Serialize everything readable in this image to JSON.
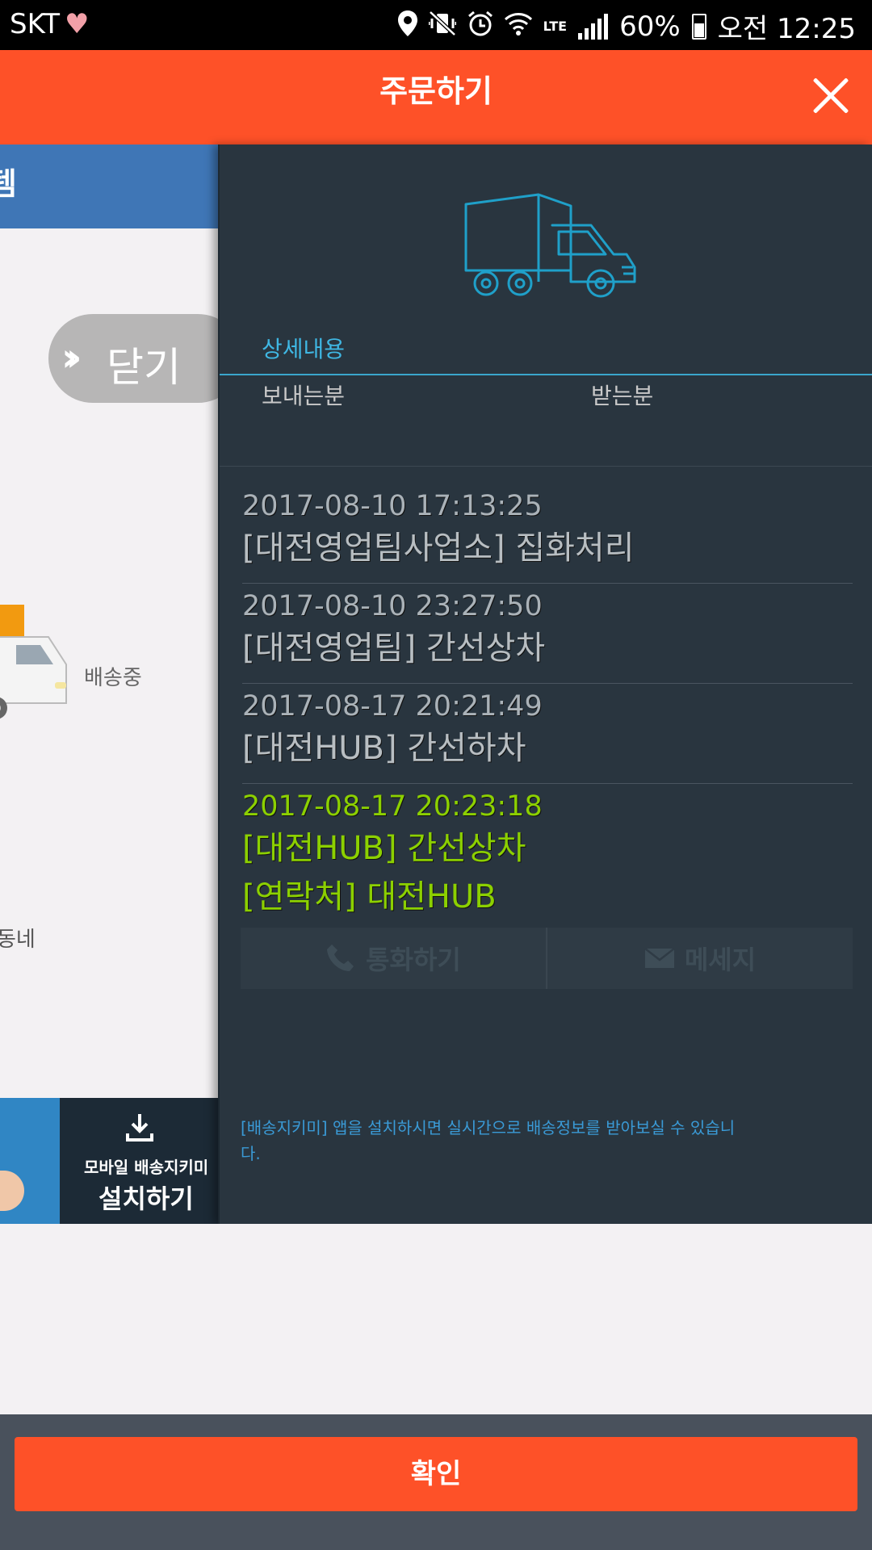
{
  "status_bar": {
    "carrier": "SKT",
    "battery": "60%",
    "clock": "오전 12:25",
    "network": "LTE",
    "icons": [
      "heart-icon",
      "location-icon",
      "vibrate-icon",
      "alarm-icon",
      "wifi-icon",
      "signal-icon",
      "battery-icon"
    ]
  },
  "header": {
    "title": "주문하기"
  },
  "left_page": {
    "top_bar_text": "템",
    "close_pill_label": "닫기",
    "delivering_label": "배송중",
    "neighbor_label": "동네",
    "banner_sub": "모바일 배송지키미",
    "banner_main": "설치하기"
  },
  "panel": {
    "tab": "상세내용",
    "sender_label": "보내는분",
    "receiver_label": "받는분",
    "tracking": [
      {
        "date": "2017-08-10 17:13:25",
        "desc": "[대전영업팀사업소] 집화처리"
      },
      {
        "date": "2017-08-10 23:27:50",
        "desc": "[대전영업팀] 간선상차"
      },
      {
        "date": "2017-08-17 20:21:49",
        "desc": "[대전HUB] 간선하차"
      },
      {
        "date": "2017-08-17 20:23:18",
        "desc": "[대전HUB] 간선상차",
        "contact": "[연락처] 대전HUB"
      }
    ],
    "call_label": "통화하기",
    "message_label": "메세지",
    "notice": "[배송지키미] 앱을 설치하시면 실시간으로 배송정보를 받아보실 수 있습니다."
  },
  "footer": {
    "confirm_label": "확인"
  },
  "colors": {
    "accent": "#fe5128",
    "panel_bg": "#29353f",
    "current_status": "#8cd000",
    "tab_blue": "#3fb7e3"
  }
}
